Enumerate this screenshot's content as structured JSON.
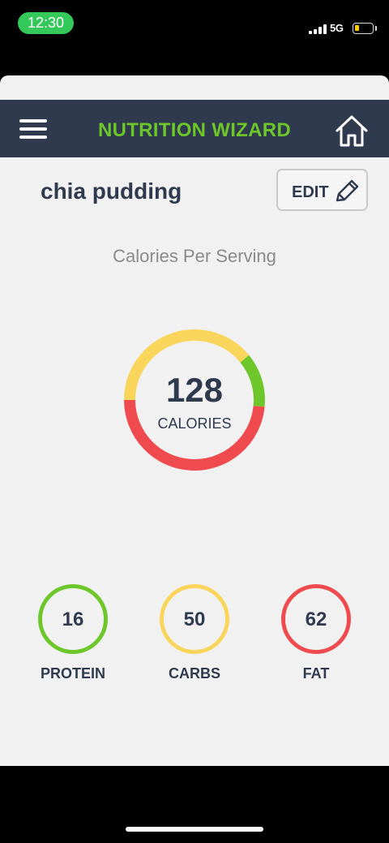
{
  "status_bar": {
    "time": "12:30",
    "network": "5G",
    "colors": {
      "time_pill": "#34c759",
      "battery": "#ffcc00"
    }
  },
  "header": {
    "title": "NUTRITION WIZARD",
    "menu_icon": "hamburger-menu-icon",
    "home_icon": "home-icon",
    "colors": {
      "background": "#2f3a4e",
      "title": "#6dc72a"
    }
  },
  "recipe": {
    "name": "chia pudding",
    "edit_label": "EDIT",
    "edit_icon": "pencil-icon"
  },
  "calories": {
    "section_label": "Calories Per Serving",
    "value": "128",
    "unit": "CALORIES"
  },
  "chart_data": {
    "type": "pie",
    "title": "",
    "series": [
      {
        "value": 50,
        "color": "#f9d55c"
      },
      {
        "value": 16,
        "color": "#6dc72a"
      },
      {
        "value": 62,
        "color": "#ef4b4f"
      }
    ]
  },
  "macros": [
    {
      "value": "16",
      "label": "PROTEIN",
      "color": "#6dc72a"
    },
    {
      "value": "50",
      "label": "CARBS",
      "color": "#f9d55c"
    },
    {
      "value": "62",
      "label": "FAT",
      "color": "#ef4b4f"
    }
  ]
}
